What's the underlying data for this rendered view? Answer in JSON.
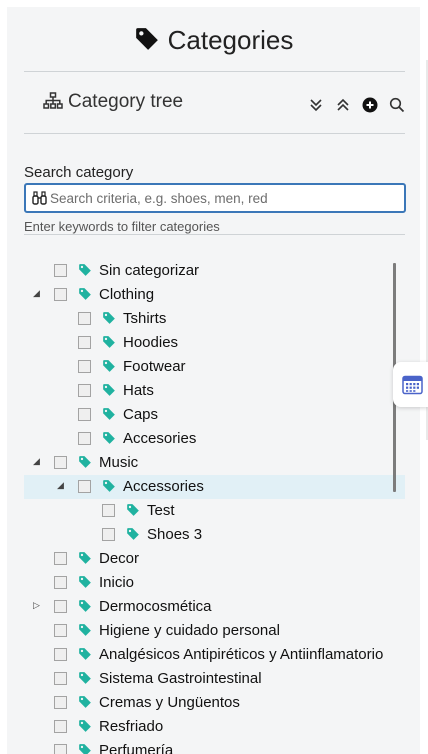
{
  "header": {
    "title": "Categories",
    "icon": "tag-icon"
  },
  "tree_panel": {
    "title": "Category tree",
    "icon": "sitemap-icon",
    "tools": [
      "expand-all-icon",
      "collapse-all-icon",
      "add-circle-icon",
      "search-icon"
    ]
  },
  "search": {
    "label": "Search category",
    "placeholder": "Search criteria, e.g. shoes, men, red",
    "value": "",
    "hint": "Enter keywords to filter categories",
    "icon": "binoculars-icon"
  },
  "tree": {
    "nodes": [
      {
        "label": "Sin categorizar",
        "depth": 0,
        "expander": "none"
      },
      {
        "label": "Clothing",
        "depth": 0,
        "expander": "expanded"
      },
      {
        "label": "Tshirts",
        "depth": 1,
        "expander": "none"
      },
      {
        "label": "Hoodies",
        "depth": 1,
        "expander": "none"
      },
      {
        "label": "Footwear",
        "depth": 1,
        "expander": "none"
      },
      {
        "label": "Hats",
        "depth": 1,
        "expander": "none"
      },
      {
        "label": "Caps",
        "depth": 1,
        "expander": "none"
      },
      {
        "label": "Accesories",
        "depth": 1,
        "expander": "none"
      },
      {
        "label": "Music",
        "depth": 0,
        "expander": "expanded"
      },
      {
        "label": "Accessories",
        "depth": 1,
        "expander": "expanded",
        "selected": true
      },
      {
        "label": "Test",
        "depth": 2,
        "expander": "none"
      },
      {
        "label": "Shoes 3",
        "depth": 2,
        "expander": "none"
      },
      {
        "label": "Decor",
        "depth": 0,
        "expander": "none"
      },
      {
        "label": "Inicio",
        "depth": 0,
        "expander": "none"
      },
      {
        "label": "Dermocosmética",
        "depth": 0,
        "expander": "collapsed"
      },
      {
        "label": "Higiene y cuidado personal",
        "depth": 0,
        "expander": "none"
      },
      {
        "label": "Analgésicos Antipiréticos y Antiinflamatorio",
        "depth": 0,
        "expander": "none"
      },
      {
        "label": "Sistema Gastrointestinal",
        "depth": 0,
        "expander": "none"
      },
      {
        "label": "Cremas y Ungüentos",
        "depth": 0,
        "expander": "none"
      },
      {
        "label": "Resfriado",
        "depth": 0,
        "expander": "none"
      },
      {
        "label": "Perfumería",
        "depth": 0,
        "expander": "none"
      }
    ]
  },
  "side_button": {
    "icon": "calendar-icon"
  },
  "colors": {
    "accent": "#3b77b8",
    "tag": "#20b2a0",
    "selected_row": "#e1f0f6"
  }
}
